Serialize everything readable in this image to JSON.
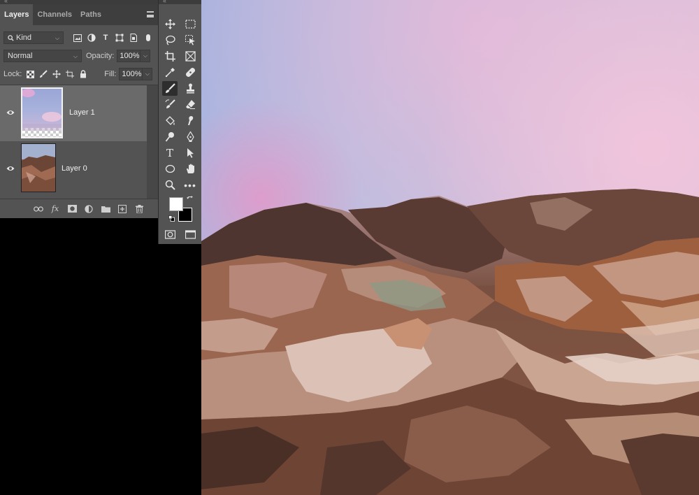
{
  "layers_panel": {
    "tabs": [
      {
        "label": "Layers",
        "active": true
      },
      {
        "label": "Channels",
        "active": false
      },
      {
        "label": "Paths",
        "active": false
      }
    ],
    "filter": {
      "value": "Kind"
    },
    "blend_mode": {
      "value": "Normal"
    },
    "opacity": {
      "label": "Opacity:",
      "value": "100%"
    },
    "lock": {
      "label": "Lock:"
    },
    "fill": {
      "label": "Fill:",
      "value": "100%"
    },
    "layers": [
      {
        "name": "Layer 1",
        "visible": true,
        "selected": true
      },
      {
        "name": "Layer 0",
        "visible": true,
        "selected": false
      }
    ],
    "bottom_icons": [
      "link-icon",
      "fx-icon",
      "mask-icon",
      "adjustment-icon",
      "folder-icon",
      "new-layer-icon",
      "trash-icon"
    ]
  },
  "tools_panel": {
    "tools": [
      "move-tool",
      "marquee-tool",
      "lasso-tool",
      "object-select-tool",
      "crop-tool",
      "frame-tool",
      "eyedropper-tool",
      "healing-tool",
      "brush-tool",
      "stamp-tool",
      "history-brush-tool",
      "eraser-tool",
      "paint-bucket-tool",
      "smudge-tool",
      "dodge-tool",
      "pen-tool",
      "type-tool",
      "path-select-tool",
      "ellipse-tool",
      "hand-tool",
      "zoom-tool",
      "more-tools"
    ],
    "active_tool": "brush-tool",
    "foreground_color": "#ffffff",
    "background_color": "#000000"
  },
  "colors": {
    "panel_bg": "#535353",
    "panel_dark": "#3e3e3e",
    "selected_row": "#6a6a6a"
  }
}
